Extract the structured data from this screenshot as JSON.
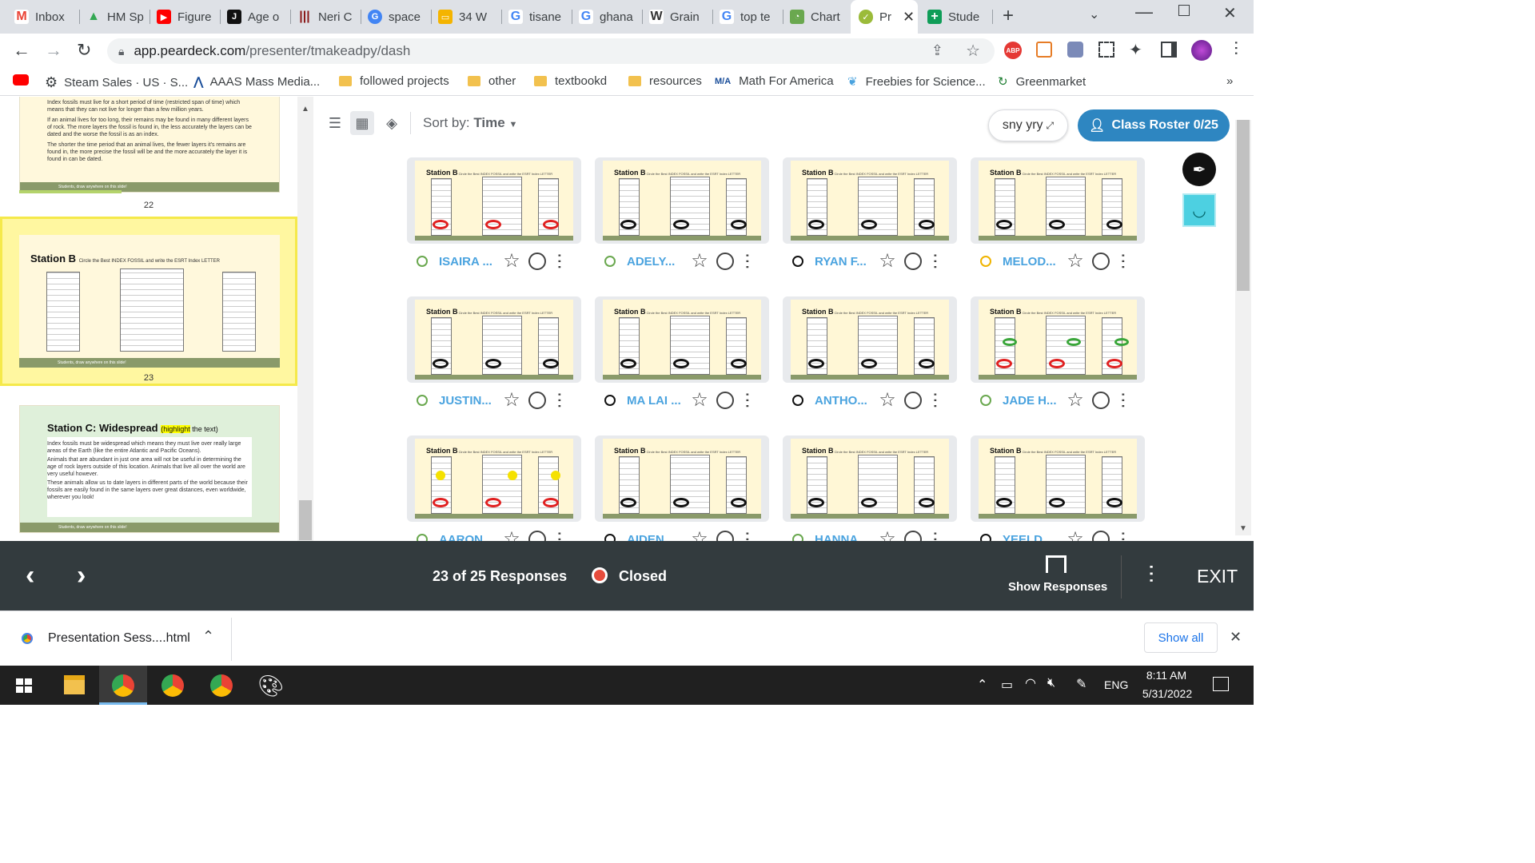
{
  "browser": {
    "tabs": [
      {
        "label": "Inbox",
        "icon": "gmail-icon",
        "color": "#ea4335"
      },
      {
        "label": "HM Sp",
        "icon": "drive-icon",
        "color": "#34a853"
      },
      {
        "label": "Figure",
        "icon": "youtube-icon",
        "color": "#ff0000"
      },
      {
        "label": "Age o",
        "icon": "j-icon",
        "color": "#111111"
      },
      {
        "label": "Neri C",
        "icon": "bars-icon",
        "color": "#8b1a1a"
      },
      {
        "label": "space",
        "icon": "google-lens-icon",
        "color": "#4285f4"
      },
      {
        "label": "34 W",
        "icon": "slides-icon",
        "color": "#f4b400"
      },
      {
        "label": "tisane",
        "icon": "google-icon",
        "color": "#4285f4"
      },
      {
        "label": "ghana",
        "icon": "google-icon",
        "color": "#4285f4"
      },
      {
        "label": "Grain",
        "icon": "wikipedia-icon",
        "color": "#333333"
      },
      {
        "label": "top te",
        "icon": "google-icon",
        "color": "#4285f4"
      },
      {
        "label": "Chart",
        "icon": "chart-icon",
        "color": "#6aa84f"
      },
      {
        "label": "Pr",
        "icon": "peardeck-icon",
        "color": "#9bbb3a"
      },
      {
        "label": "Stude",
        "icon": "plus-icon",
        "color": "#0f9d58"
      }
    ],
    "url_domain": "app.peardeck.com",
    "url_path": "/presenter/tmakeadpy/dash",
    "bookmarks": [
      {
        "label": "",
        "icon": "youtube-icon"
      },
      {
        "label": "Steam Sales · US · S...",
        "icon": "steam-icon"
      },
      {
        "label": "AAAS Mass Media...",
        "icon": "aaas-icon"
      },
      {
        "label": "followed projects",
        "icon": "folder-icon"
      },
      {
        "label": "other",
        "icon": "folder-icon"
      },
      {
        "label": "textbookd",
        "icon": "folder-icon"
      },
      {
        "label": "resources",
        "icon": "folder-icon"
      },
      {
        "label": "Math For America",
        "icon": "mfa-icon"
      },
      {
        "label": "Freebies for Science...",
        "icon": "leaf-icon"
      },
      {
        "label": "Greenmarket",
        "icon": "greenmarket-icon"
      }
    ]
  },
  "slides": [
    {
      "number": "22",
      "paragraphs": [
        "Index fossils must live for a short period of time (restricted span of time) which means that they can not live for longer than a few million years.",
        "If an animal lives for too long, their remains may be found in many different layers of rock. The more layers the fossil is found in, the less accurately the layers can be dated and the worse the fossil is as an index.",
        "The shorter the time period that an animal lives, the fewer layers it's remains are found in, the more precise the fossil will be and the more accurately the layer it is found in can be dated."
      ],
      "footer": "Students, draw anywhere on this slide!"
    },
    {
      "number": "23",
      "title": "Station B",
      "subtitle": "Circle the Best INDEX FOSSIL and write the ESRT Index LETTER",
      "footer": "Students, draw anywhere on this slide!"
    },
    {
      "title": "Station C:  Widespread",
      "highlight": "highlight",
      "title_suffix": " the text)",
      "paragraphs": [
        "Index fossils must be widespread which means they must live over really large areas of the Earth (like the entire Atlantic and Pacific Oceans).",
        "Animals that are abundant in just one area will not be useful in determining the age of rock layers outside of this location. Animals that live all over the world are very useful however.",
        "These animals allow us to date layers in different parts of the world because their fossils are easily found in the same layers over great distances, even worldwide, wherever you look!"
      ],
      "footer": "Students, draw anywhere on this slide!"
    }
  ],
  "toolbar": {
    "sort_label": "Sort by:",
    "sort_value": "Time",
    "session_name": "sny yry",
    "roster_label": "Class Roster 0/25"
  },
  "responses": [
    {
      "name": "ISAIRA ...",
      "mood": "happy",
      "mark": "red"
    },
    {
      "name": "ADELY...",
      "mood": "happy",
      "mark": "black"
    },
    {
      "name": "RYAN F...",
      "mood": "neutral",
      "mark": "black"
    },
    {
      "name": "MELOD...",
      "mood": "happy-yellow",
      "mark": "black"
    },
    {
      "name": "JUSTIN...",
      "mood": "happy",
      "mark": "black"
    },
    {
      "name": "MA LAI ...",
      "mood": "neutral",
      "mark": "black"
    },
    {
      "name": "ANTHO...",
      "mood": "neutral",
      "mark": "black"
    },
    {
      "name": "JADE H...",
      "mood": "happy",
      "mark": "red-green"
    },
    {
      "name": "AARON",
      "mood": "happy",
      "mark": "red-yellow"
    },
    {
      "name": "AIDEN",
      "mood": "neutral",
      "mark": "black"
    },
    {
      "name": "HANNA",
      "mood": "happy",
      "mark": "black"
    },
    {
      "name": "YEELD",
      "mood": "neutral",
      "mark": "black"
    }
  ],
  "card_title": "Station B",
  "card_subtitle": "Circle the Best INDEX FOSSIL and write the ESRT Index LETTER",
  "footer_bar": {
    "responses": "23 of 25 Responses",
    "status": "Closed",
    "show_responses": "Show Responses",
    "exit": "EXIT"
  },
  "downloads": {
    "file": "Presentation Sess....html",
    "show_all": "Show all"
  },
  "taskbar": {
    "language": "ENG",
    "time": "8:11 AM",
    "date": "5/31/2022"
  }
}
